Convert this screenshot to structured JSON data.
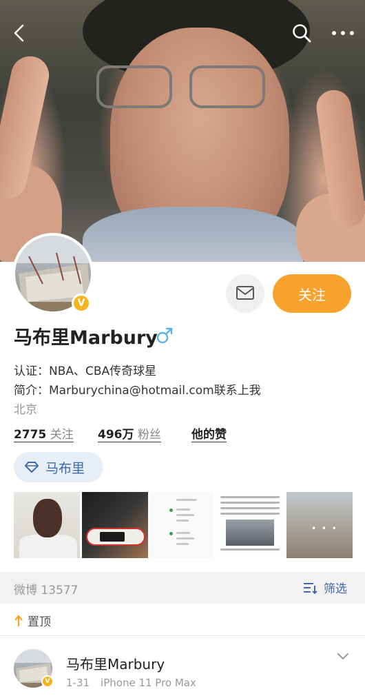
{
  "profile": {
    "name": "马布里Marbury",
    "verification": "认证：NBA、CBA传奇球星",
    "bio": "简介：Marburychina@hotmail.com联系上我",
    "location": "北京",
    "follow_label": "关注",
    "following_count": "2775",
    "following_label": "关注",
    "followers_count": "496万",
    "followers_label": "粉丝",
    "likes_label": "他的赞",
    "tag_label": "马布里",
    "verified_badge": "V"
  },
  "icons": {
    "back": "chevron-left-icon",
    "search": "search-icon",
    "more": "more-dots-icon",
    "message": "message-icon",
    "gender": "male-icon",
    "tag": "diamond-icon",
    "filter": "filter-icon",
    "pin": "up-arrow-icon",
    "chevron": "chevron-down-icon"
  },
  "colors": {
    "accent": "#f8a22e",
    "link_blue": "#3e6aa8",
    "verified": "#f5b51f",
    "gender_blue": "#5ab3e6"
  },
  "thumbnails": {
    "t5_overlay": "• • •"
  },
  "feed": {
    "weibo_label": "微博 13577",
    "filter_label": "筛选",
    "pinned_label": "置顶"
  },
  "post": {
    "author": "马布里Marbury",
    "date": "1-31",
    "device": "iPhone 11 Pro Max",
    "verified_badge": "V"
  }
}
